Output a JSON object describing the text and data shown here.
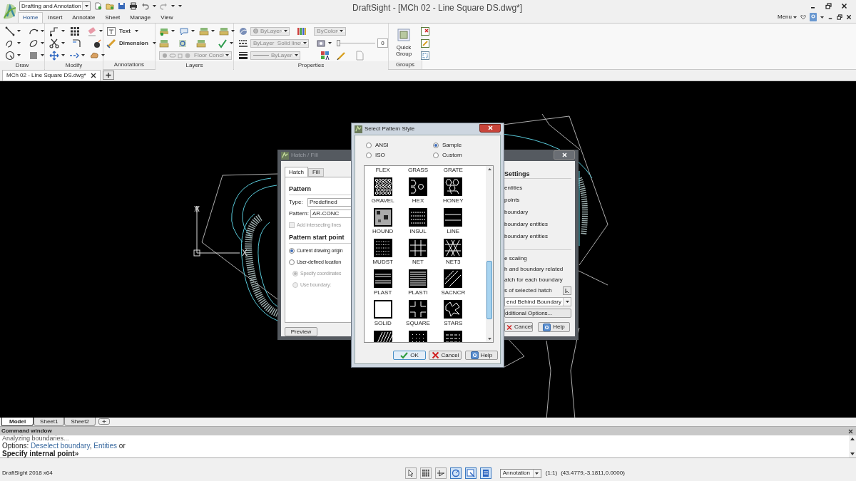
{
  "app": {
    "workspace": "Drafting and Annotation",
    "title": "DraftSight - [MCh 02 - Line Square DS.dwg*]",
    "menu": "Menu"
  },
  "ribbon_tabs": [
    {
      "label": "Home",
      "selected": true
    },
    {
      "label": "Insert",
      "selected": false
    },
    {
      "label": "Annotate",
      "selected": false
    },
    {
      "label": "Sheet",
      "selected": false
    },
    {
      "label": "Manage",
      "selected": false
    },
    {
      "label": "View",
      "selected": false
    }
  ],
  "ribbon_panels": [
    {
      "kind": "draw",
      "label": "Draw"
    },
    {
      "kind": "modify",
      "label": "Modify"
    },
    {
      "kind": "annotations",
      "label": "Annotations",
      "tools": [
        "Text",
        "Dimension"
      ]
    },
    {
      "kind": "layers",
      "label": "Layers",
      "layer": "Floor Conci",
      "disabled": true
    },
    {
      "kind": "properties",
      "label": "Properties",
      "disabled": true,
      "color_setting": "ByLayer",
      "linestyle": "ByLayer",
      "linestyle_name": "Solid line",
      "lineweight": "ByLayer",
      "plot_style": "ByColor",
      "transparency": {
        "value": "0",
        "level": 0
      }
    },
    {
      "kind": "groups",
      "label": "Groups",
      "button": "Quick Group"
    }
  ],
  "document_tabs": [
    {
      "label": "MCh 02 - Line Square DS.dwg*",
      "selected": true
    }
  ],
  "canvas": {
    "ucs": {
      "y_label": "Y",
      "x_label": "X"
    }
  },
  "hatch_dialog": {
    "title": "Hatch / Fill",
    "tabs": [
      {
        "label": "Hatch",
        "selected": true
      },
      {
        "label": "Fill",
        "selected": false
      }
    ],
    "pattern_heading": "Pattern",
    "type_label": "Type:",
    "type_value": "Predefined",
    "pattern_label": "Pattern:",
    "pattern_value": "AR-CONC",
    "intersect": {
      "label": "Add intersecting lines",
      "checked": false,
      "disabled": true
    },
    "start_heading": "Pattern start point",
    "origin_options": [
      {
        "label": "Current drawing origin",
        "selected": true,
        "disabled": false
      },
      {
        "label": "User-defined location",
        "selected": false,
        "disabled": false
      }
    ],
    "location_options": [
      {
        "label": "Specify coordinates",
        "selected": true,
        "disabled": true
      },
      {
        "label": "Use boundary:",
        "selected": false,
        "disabled": true
      }
    ],
    "preview": "Preview",
    "settings_heading": "Settings",
    "boundary_items": [
      "entities",
      "points",
      "boundary",
      "boundary entities",
      "boundary entities"
    ],
    "options": [
      "e scaling",
      "h and boundary related",
      "atch for each boundary",
      "s of selected hatch"
    ],
    "draw_order": "end Behind Boundary",
    "more": "dditional Options...",
    "cancel": "Cancel",
    "help": "Help"
  },
  "pattern_dialog": {
    "title": "Select Pattern Style",
    "types": [
      {
        "label": "ANSI",
        "selected": false
      },
      {
        "label": "Sample",
        "selected": true
      },
      {
        "label": "ISO",
        "selected": false
      },
      {
        "label": "Custom",
        "selected": false
      }
    ],
    "patterns": [
      {
        "kind": "offscreen",
        "label": "FLEX"
      },
      {
        "kind": "offscreen",
        "label": "GRASS"
      },
      {
        "kind": "offscreen",
        "label": "GRATE"
      },
      {
        "kind": "gravel",
        "label": "GRAVEL"
      },
      {
        "kind": "hex",
        "label": "HEX"
      },
      {
        "kind": "honey",
        "label": "HONEY"
      },
      {
        "kind": "hound",
        "label": "HOUND"
      },
      {
        "kind": "insul",
        "label": "INSUL"
      },
      {
        "kind": "line",
        "label": "LINE"
      },
      {
        "kind": "mudst",
        "label": "MUDST"
      },
      {
        "kind": "net",
        "label": "NET"
      },
      {
        "kind": "net3",
        "label": "NET3"
      },
      {
        "kind": "plast",
        "label": "PLAST"
      },
      {
        "kind": "plasti",
        "label": "PLASTI"
      },
      {
        "kind": "sacncr",
        "label": "SACNCR"
      },
      {
        "kind": "solid",
        "label": "SOLID"
      },
      {
        "kind": "square",
        "label": "SQUARE"
      },
      {
        "kind": "stars",
        "label": "STARS"
      },
      {
        "kind": "diagonal"
      },
      {
        "kind": "dots"
      },
      {
        "kind": "dashes"
      }
    ],
    "ok": "OK",
    "cancel": "Cancel",
    "help": "Help"
  },
  "sheet_tabs": [
    {
      "kind": "model",
      "label": "Model",
      "selected": true
    },
    {
      "kind": "sheet",
      "label": "Sheet1",
      "selected": false
    },
    {
      "kind": "sheet",
      "label": "Sheet2",
      "selected": false
    }
  ],
  "command_window": {
    "title": "Command window",
    "lines": [
      {
        "kind": "plain",
        "text": "Analyzing boundaries..."
      },
      {
        "kind": "options",
        "parts": [
          {
            "text": "Options: "
          },
          {
            "link": "Deselect boundary"
          },
          {
            "text": ", "
          },
          {
            "link": "Entities"
          },
          {
            "text": " or"
          }
        ]
      },
      {
        "kind": "prompt",
        "text": "Specify internal point»"
      }
    ]
  },
  "status_bar": {
    "app": "DraftSight 2018 x64",
    "toggles": [
      {
        "on": false
      },
      {
        "on": false
      },
      {
        "on": false
      },
      {
        "on": true
      },
      {
        "on": true
      },
      {
        "on": true
      }
    ],
    "annotation": "Annotation",
    "scale": "(1:1)",
    "coords": "(43.4779,-3.1811,0.0000)"
  }
}
